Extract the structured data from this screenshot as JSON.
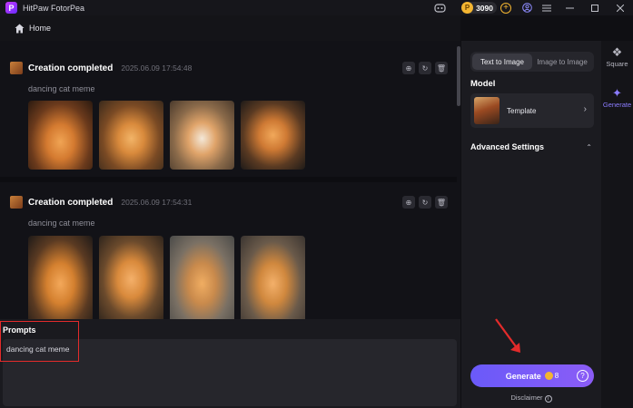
{
  "app": {
    "title": "HitPaw FotorPea",
    "logo_letter": "P"
  },
  "titlebar": {
    "coins": "3090",
    "icons": [
      "discord-icon",
      "coin-icon",
      "add-coins-icon",
      "account-icon",
      "menu-icon",
      "minimize-icon",
      "maximize-icon",
      "close-icon"
    ]
  },
  "nav": {
    "home_label": "Home"
  },
  "feed": {
    "cards": [
      {
        "title": "Creation completed",
        "time": "2025.06.09 17:54:48",
        "prompt": "dancing cat meme",
        "image_count": 4
      },
      {
        "title": "Creation completed",
        "time": "2025.06.09 17:54:31",
        "prompt": "dancing cat meme",
        "image_count": 4
      }
    ]
  },
  "prompts": {
    "label": "Prompts",
    "value": "dancing cat meme"
  },
  "panel": {
    "tabs": [
      {
        "label": "Text to Image",
        "active": true
      },
      {
        "label": "Image to Image",
        "active": false
      }
    ],
    "model_label": "Model",
    "model_name": "Template",
    "advanced_label": "Advanced Settings",
    "generate_label": "Generate",
    "generate_cost": "8",
    "disclaimer": "Disclaimer"
  },
  "strip": {
    "items": [
      {
        "label": "Square",
        "icon": "square-icon",
        "active": false
      },
      {
        "label": "Generate",
        "icon": "sparkle-icon",
        "active": true
      }
    ]
  },
  "colors": {
    "accent": "#7c5cf7",
    "highlight": "#e32b2b",
    "coin": "#f3b531"
  }
}
